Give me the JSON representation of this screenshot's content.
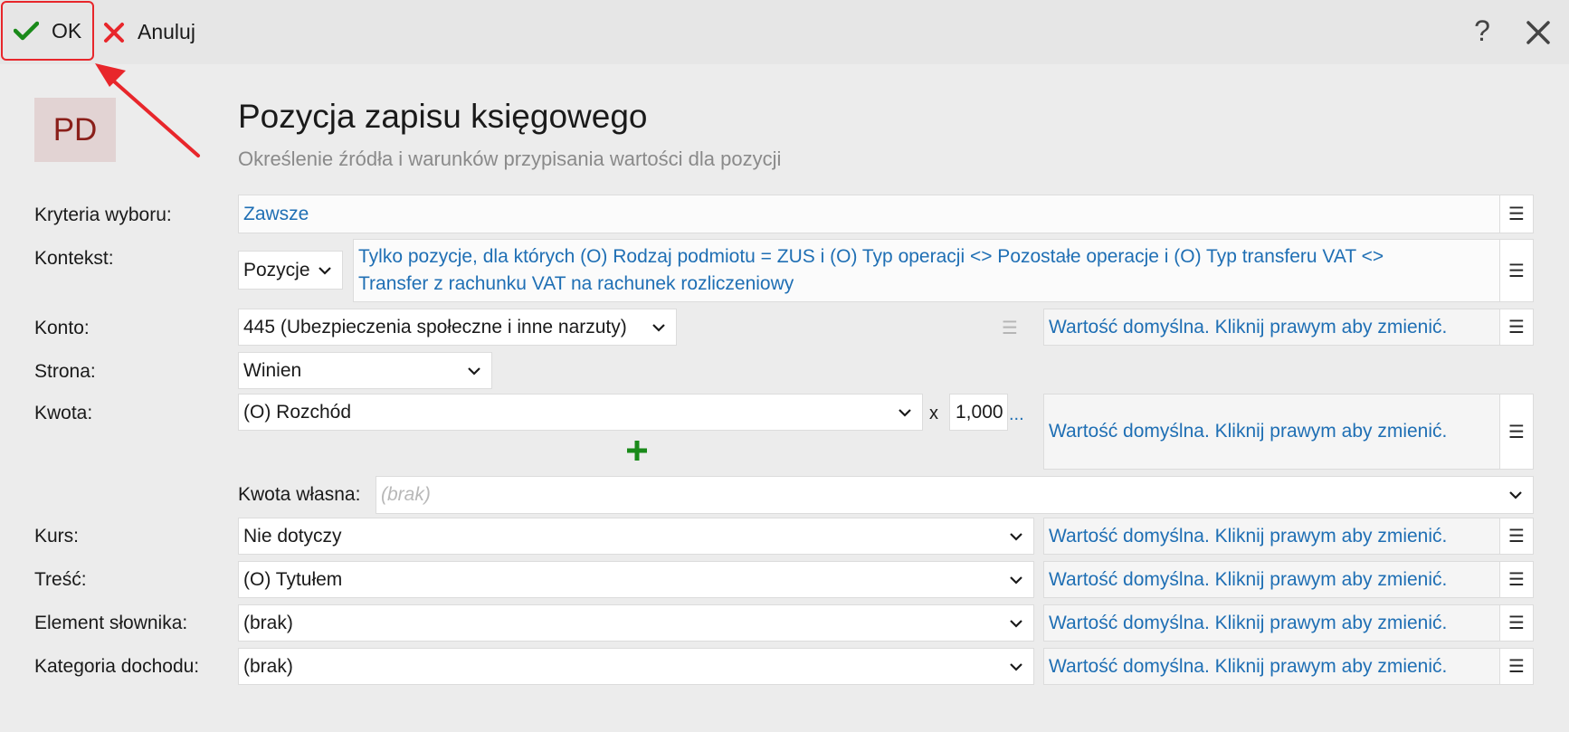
{
  "toolbar": {
    "ok_label": "OK",
    "cancel_label": "Anuluj",
    "help_glyph": "?",
    "icons": {
      "ok": "check-icon",
      "cancel": "x-icon",
      "help": "help-icon",
      "close": "close-icon"
    },
    "colors": {
      "ok": "#1a8a1a",
      "cancel": "#e8262b",
      "highlight": "#e8262b"
    }
  },
  "header": {
    "logo": "PD",
    "title": "Pozycja zapisu księgowego",
    "subtitle": "Określenie źródła i warunków przypisania wartości dla pozycji"
  },
  "form": {
    "kryteria": {
      "label": "Kryteria wyboru:",
      "value": "Zawsze"
    },
    "kontekst": {
      "label": "Kontekst:",
      "select_value": "Pozycje",
      "description_line1": "Tylko pozycje, dla których (O) Rodzaj podmiotu = ZUS i (O) Typ operacji <> Pozostałe operacje i (O) Typ transferu VAT <>",
      "description_line2": "Transfer z rachunku VAT na rachunek rozliczeniowy"
    },
    "konto": {
      "label": "Konto:",
      "value": "445 (Ubezpieczenia społeczne i inne narzuty)",
      "default_text": "Wartość domyślna. Kliknij prawym aby zmienić."
    },
    "strona": {
      "label": "Strona:",
      "value": "Winien"
    },
    "kwota": {
      "label": "Kwota:",
      "value": "(O) Rozchód",
      "multiplier_sign": "x",
      "multiplier": "1,000",
      "ellipsis": "...",
      "default_text": "Wartość domyślna. Kliknij prawym aby zmienić.",
      "add_icon": "plus-icon",
      "add_color": "#1a8a1a"
    },
    "kwota_wlasna": {
      "label": "Kwota własna:",
      "placeholder": "(brak)"
    },
    "kurs": {
      "label": "Kurs:",
      "value": "Nie dotyczy",
      "default_text": "Wartość domyślna. Kliknij prawym aby zmienić."
    },
    "tresc": {
      "label": "Treść:",
      "value": "(O) Tytułem",
      "default_text": "Wartość domyślna. Kliknij prawym aby zmienić."
    },
    "element": {
      "label": "Element słownika:",
      "value": "(brak)",
      "default_text": "Wartość domyślna. Kliknij prawym aby zmienić."
    },
    "kategoria": {
      "label": "Kategoria dochodu:",
      "value": "(brak)",
      "default_text": "Wartość domyślna. Kliknij prawym aby zmienić."
    },
    "menu_glyph": "☰"
  }
}
